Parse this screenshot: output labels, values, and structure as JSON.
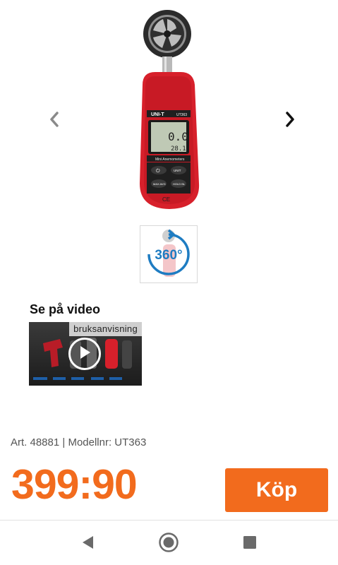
{
  "gallery": {
    "prev_icon": "chevron-left-icon",
    "next_icon": "chevron-right-icon",
    "product_brand": "UNI-T",
    "product_model": "UT363",
    "display_reading_1": "0.0",
    "display_reading_2": "28.1",
    "device_caption": "Mini Anemometers",
    "key_power": "⏻",
    "key_unit": "UNIT",
    "key_maxavg": "MAX AVG",
    "key_hold": "HOLD BL",
    "ce_mark": "CE",
    "thumb_360_label": "360°"
  },
  "video": {
    "heading": "Se på video",
    "label": "bruksanvisning",
    "play_icon": "play-icon"
  },
  "product": {
    "article_line": "Art. 48881 | Modellnr: UT363",
    "price": "399:90",
    "buy_label": "Köp"
  },
  "colors": {
    "accent": "#f26b1d",
    "device_red": "#d7202b"
  },
  "system_nav": {
    "back_icon": "back-triangle-icon",
    "home_icon": "home-circle-icon",
    "recents_icon": "recents-square-icon"
  }
}
